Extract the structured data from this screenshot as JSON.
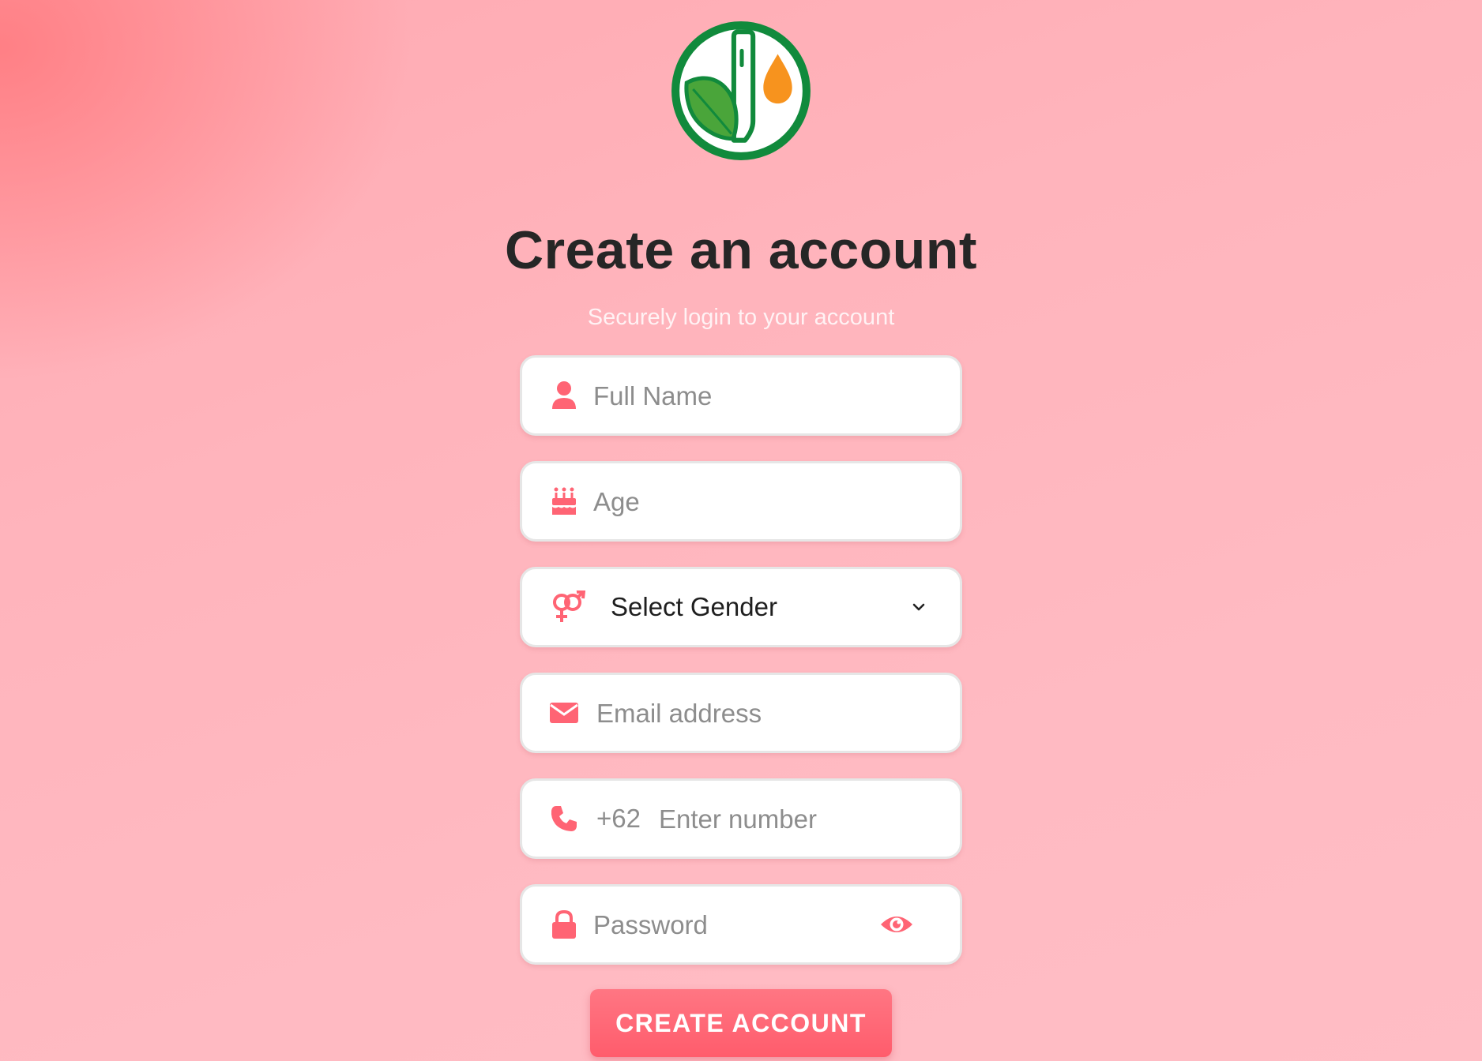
{
  "header": {
    "title": "Create an account",
    "subtitle": "Securely login to your account"
  },
  "form": {
    "full_name": {
      "placeholder": "Full Name",
      "icon": "user-icon"
    },
    "age": {
      "placeholder": "Age",
      "icon": "birthday-cake-icon"
    },
    "gender": {
      "selected": "Select Gender",
      "icon": "venus-mars-icon"
    },
    "email": {
      "placeholder": "Email address",
      "icon": "envelope-icon"
    },
    "phone": {
      "prefix": "+62",
      "placeholder": "Enter number",
      "icon": "phone-icon"
    },
    "password": {
      "placeholder": "Password",
      "icon": "lock-icon",
      "toggle_icon": "eye-icon"
    },
    "submit_label": "CREATE ACCOUNT"
  },
  "colors": {
    "accent": "#ff6474",
    "logo_green": "#118a3c",
    "logo_leaf": "#4aa53a",
    "logo_drop": "#f7931e"
  }
}
